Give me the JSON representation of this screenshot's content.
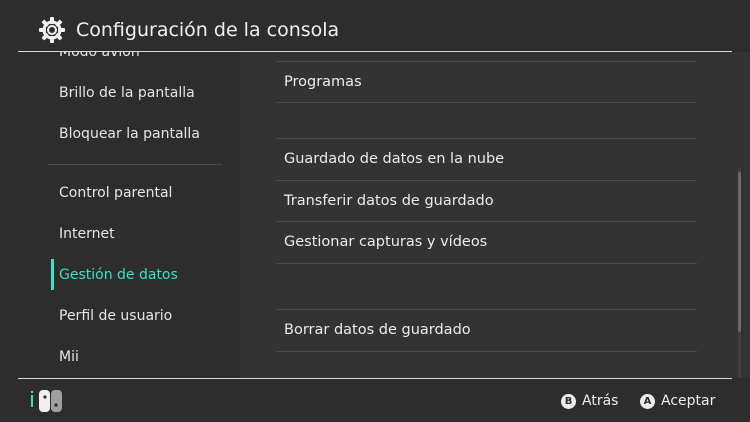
{
  "header": {
    "title": "Configuración de la consola",
    "icon": "gear-icon"
  },
  "sidebar": {
    "items": [
      {
        "label": "Modo avión"
      },
      {
        "label": "Brillo de la pantalla"
      },
      {
        "label": "Bloquear la pantalla"
      },
      {
        "label": "Control parental"
      },
      {
        "label": "Internet"
      },
      {
        "label": "Gestión de datos",
        "active": true
      },
      {
        "label": "Perfil de usuario"
      },
      {
        "label": "Mii"
      }
    ]
  },
  "content": {
    "rows": [
      {
        "label": "Programas"
      },
      {
        "label": "Guardado de datos en la nube"
      },
      {
        "label": "Transferir datos de guardado"
      },
      {
        "label": "Gestionar capturas y vídeos"
      },
      {
        "label": "Borrar datos de guardado"
      }
    ]
  },
  "footer": {
    "controller_icon": "joycon-icon",
    "back": {
      "button": "B",
      "label": "Atrás"
    },
    "accept": {
      "button": "A",
      "label": "Aceptar"
    }
  },
  "colors": {
    "accent": "#3ce0c4",
    "background": "#2d2d2d",
    "panel": "#333333"
  }
}
